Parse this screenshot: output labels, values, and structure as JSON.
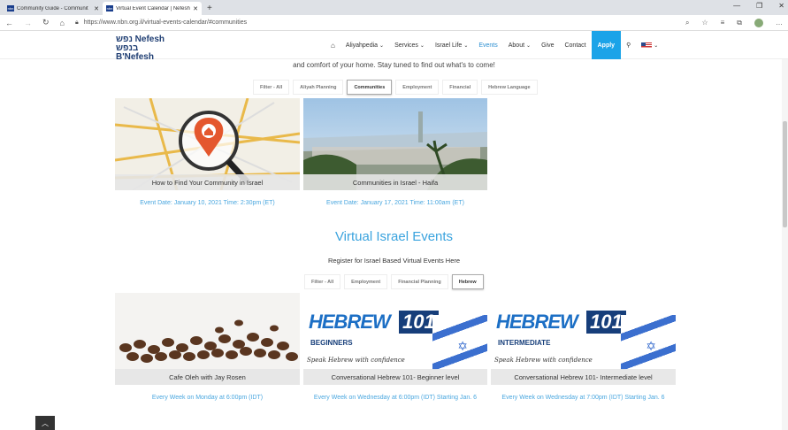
{
  "browser": {
    "tabs": [
      {
        "label": "Community Guide - Communit",
        "active": false
      },
      {
        "label": "Virtual Event Calendar | Nefesh B",
        "active": true
      }
    ],
    "url": "https://www.nbn.org.il/virtual-events-calendar/#communities"
  },
  "site": {
    "logo_line1": "נפש Nefesh",
    "logo_line2": "בנפש B'Nefesh",
    "menu": [
      {
        "label": "Aliyahpedia"
      },
      {
        "label": "Services"
      },
      {
        "label": "Israel Life"
      },
      {
        "label": "Events"
      },
      {
        "label": "About"
      },
      {
        "label": "Give"
      },
      {
        "label": "Contact"
      },
      {
        "label": "Apply"
      }
    ]
  },
  "section1": {
    "intro": "and comfort of your home.  Stay tuned to find out what's to come!",
    "filters": [
      "Filter - All",
      "Aliyah Planning",
      "Communities",
      "Employment",
      "Financial",
      "Hebrew Language"
    ],
    "selected": "Communities",
    "cards": [
      {
        "caption": "How to Find Your Community in Israel",
        "event": "Event Date: January 10, 2021 Time: 2:30pm (ET)"
      },
      {
        "caption": "Communities in Israel - Haifa",
        "event": "Event Date: January 17, 2021 Time: 11:00am (ET)"
      }
    ]
  },
  "section2": {
    "heading": "Virtual Israel Events",
    "subheading": "Register for Israel Based Virtual Events Here",
    "filters": [
      "Filter - All",
      "Employment",
      "Financial Planning",
      "Hebrew"
    ],
    "selected": "Hebrew",
    "cards": [
      {
        "caption": "Cafe Oleh with Jay Rosen",
        "event": "Every Week on Monday at 6:00pm (IDT)"
      },
      {
        "caption": "Conversational Hebrew 101- Beginner level",
        "event": "Every Week on Wednesday at 6:00pm (IDT) Starting Jan. 6"
      },
      {
        "caption": "Conversational Hebrew 101- Intermediate level",
        "event": "Every Week on Wednesday at 7:00pm (IDT) Starting Jan. 6"
      }
    ],
    "hebrew_word": "HEBREW",
    "hebrew_num": "101",
    "level_beginner": "BEGINNERS",
    "level_intermediate": "INTERMEDIATE",
    "tagline": "Speak Hebrew with confidence"
  },
  "colors": {
    "accent": "#1ba3e8",
    "link": "#4aa7df",
    "heading": "#3aa3de",
    "brand": "#1f3e73"
  }
}
